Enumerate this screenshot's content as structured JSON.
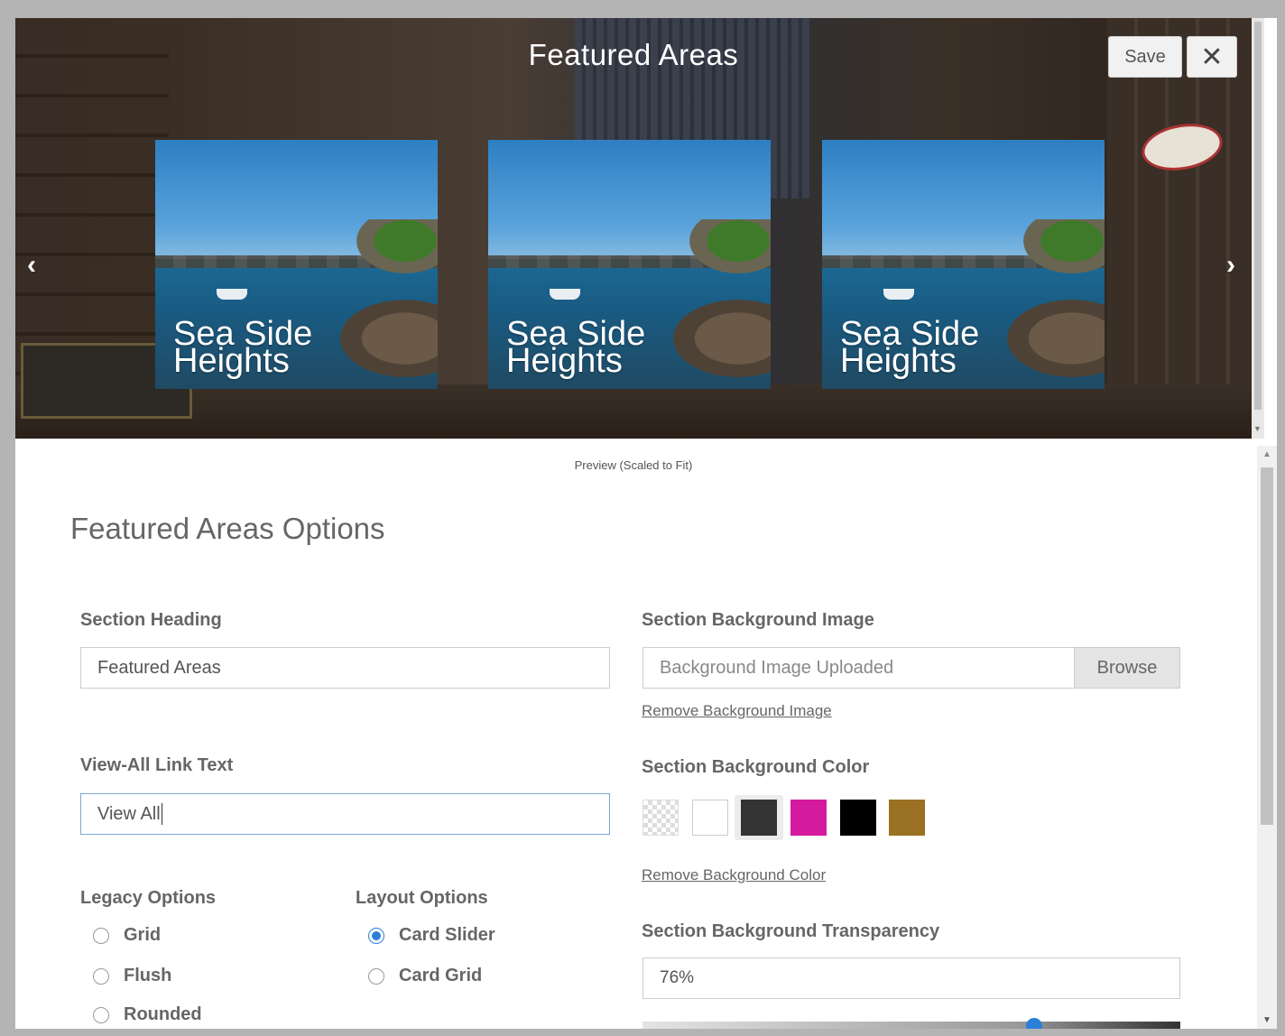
{
  "preview": {
    "title": "Featured Areas",
    "cards": [
      {
        "line1": "Sea Side",
        "line2": "Heights"
      },
      {
        "line1": "Sea Side",
        "line2": "Heights"
      },
      {
        "line1": "Sea Side",
        "line2": "Heights"
      }
    ],
    "prev_icon": "‹",
    "next_icon": "›",
    "caption": "Preview (Scaled to Fit)"
  },
  "toolbar": {
    "save_label": "Save",
    "close_label": "✕"
  },
  "options": {
    "title": "Featured Areas Options",
    "section_heading": {
      "label": "Section Heading",
      "value": "Featured Areas"
    },
    "view_all": {
      "label": "View-All Link Text",
      "value": "View All"
    },
    "legacy": {
      "label": "Legacy Options",
      "items": [
        {
          "label": "Grid",
          "checked": false
        },
        {
          "label": "Flush",
          "checked": false
        },
        {
          "label": "Rounded",
          "checked": false
        }
      ]
    },
    "layout": {
      "label": "Layout Options",
      "items": [
        {
          "label": "Card Slider",
          "checked": true
        },
        {
          "label": "Card Grid",
          "checked": false
        }
      ]
    },
    "bg_image": {
      "label": "Section Background Image",
      "value": "Background Image Uploaded",
      "browse_label": "Browse",
      "remove_label": "Remove Background Image"
    },
    "bg_color": {
      "label": "Section Background Color",
      "swatches": [
        "transparent",
        "#ffffff",
        "#333333",
        "#d41a9e",
        "#000000",
        "#9a7122"
      ],
      "selected": "#333333",
      "remove_label": "Remove Background Color"
    },
    "transparency": {
      "label": "Section Background Transparency",
      "value": "76%",
      "level": 0.76
    }
  }
}
